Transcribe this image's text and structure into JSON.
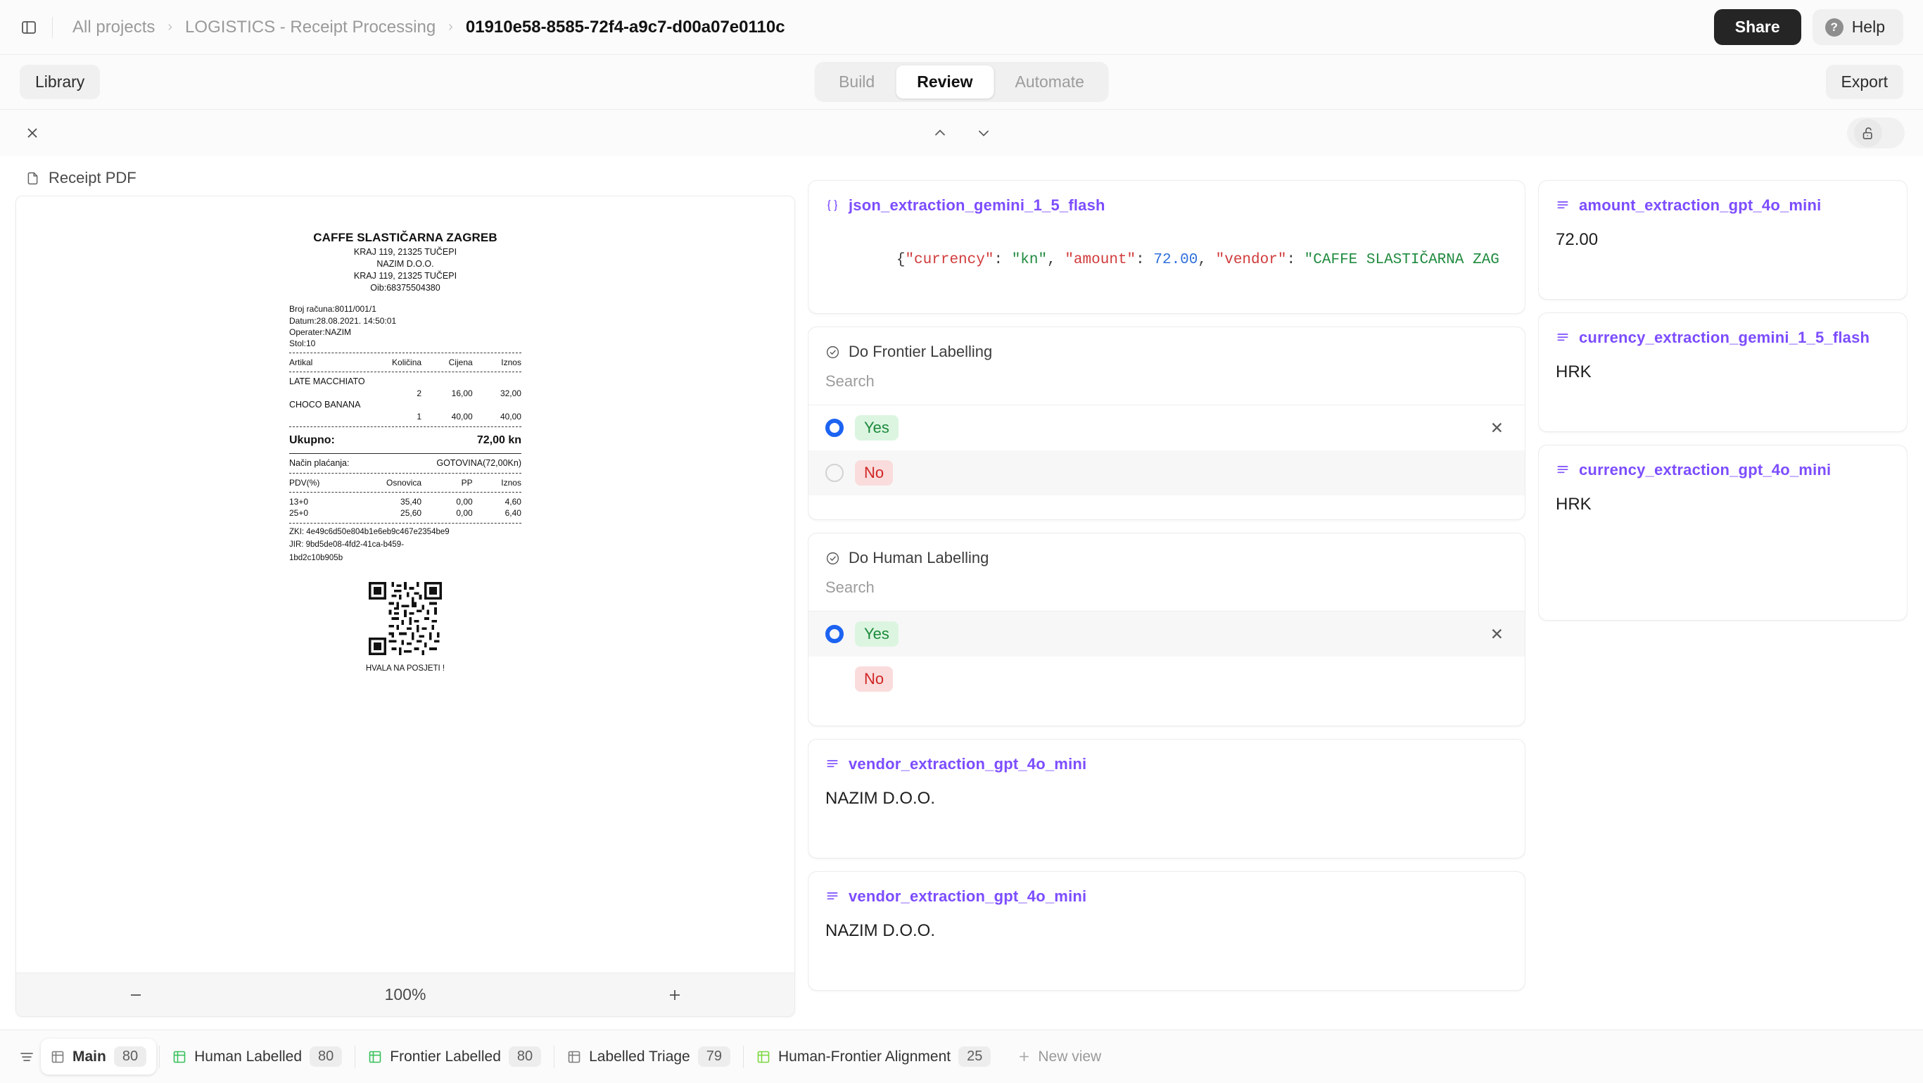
{
  "topbar": {
    "panel_toggle_icon": "panel-left-icon",
    "breadcrumb": [
      {
        "label": "All projects",
        "active": false
      },
      {
        "label": "LOGISTICS - Receipt Processing",
        "active": false
      },
      {
        "label": "01910e58-8585-72f4-a9c7-d00a07e0110c",
        "active": true
      }
    ],
    "separator": "›",
    "share_label": "Share",
    "help_label": "Help",
    "help_badge": "?"
  },
  "tabbar": {
    "library_label": "Library",
    "export_label": "Export",
    "tabs": [
      {
        "label": "Build",
        "active": false
      },
      {
        "label": "Review",
        "active": true
      },
      {
        "label": "Automate",
        "active": false
      }
    ]
  },
  "subbar": {
    "close_icon": "close-icon",
    "prev_icon": "chevron-up-icon",
    "next_icon": "chevron-down-icon",
    "lock_icon": "unlock-icon"
  },
  "pdf": {
    "tab_label": "Receipt PDF",
    "file_icon": "file-icon",
    "zoom_level": "100%",
    "zoom_out_icon": "minus-icon",
    "zoom_in_icon": "plus-icon"
  },
  "receipt": {
    "title": "CAFFE SLASTIČARNA ZAGREB",
    "address_lines": [
      "KRAJ 119, 21325 TUČEPI",
      "NAZIM D.O.O.",
      "KRAJ 119, 21325 TUČEPI",
      "Oib:68375504380"
    ],
    "meta": [
      "Broj računa:8011/001/1",
      "Datum:28.08.2021.  14:50:01",
      "Operater:NAZIM",
      "Stol:10"
    ],
    "items_header": [
      "Artikal",
      "Količina",
      "Cijena",
      "Iznos"
    ],
    "items": [
      {
        "name": "LATE MACCHIATO",
        "qty": "2",
        "price": "16,00",
        "amount": "32,00"
      },
      {
        "name": "CHOCO BANANA",
        "qty": "1",
        "price": "40,00",
        "amount": "40,00"
      }
    ],
    "total_label": "Ukupno:",
    "total_value": "72,00 kn",
    "payment_label": "Način plaćanja:",
    "payment_value": "GOTOVINA(72,00Kn)",
    "tax_header": [
      "PDV(%)",
      "Osnovica",
      "PP",
      "Iznos"
    ],
    "tax_rows": [
      {
        "rate": "13+0",
        "base": "35,40",
        "pp": "0,00",
        "amount": "4,60"
      },
      {
        "rate": "25+0",
        "base": "25,60",
        "pp": "0,00",
        "amount": "6,40"
      }
    ],
    "zki": "ZKI: 4e49c6d50e804b1e6eb9c467e2354be9",
    "jir_line1": "JIR: 9bd5de08-4fd2-41ca-b459-",
    "jir_line2": "1bd2c10b905b",
    "footer": "HVALA NA POSJETI !"
  },
  "middle": {
    "json_card": {
      "title": "json_extraction_gemini_1_5_flash",
      "icon": "braces-icon",
      "tokens": [
        {
          "t": "{",
          "c": "punc"
        },
        {
          "t": "\"currency\"",
          "c": "key"
        },
        {
          "t": ": ",
          "c": "punc"
        },
        {
          "t": "\"kn\"",
          "c": "str"
        },
        {
          "t": ", ",
          "c": "punc"
        },
        {
          "t": "\"amount\"",
          "c": "key"
        },
        {
          "t": ": ",
          "c": "punc"
        },
        {
          "t": "72.00",
          "c": "num"
        },
        {
          "t": ", ",
          "c": "punc"
        },
        {
          "t": "\"vendor\"",
          "c": "key"
        },
        {
          "t": ": ",
          "c": "punc"
        },
        {
          "t": "\"CAFFE SLASTIČARNA ZAG",
          "c": "str"
        }
      ]
    },
    "labelling": [
      {
        "title": "Do Frontier Labelling",
        "icon": "check-circle-icon",
        "search_placeholder": "Search",
        "search_value": "",
        "options": [
          {
            "label": "Yes",
            "tone": "yes",
            "selected": true,
            "hover": false,
            "has_radio": true,
            "clear_icon": "close-icon"
          },
          {
            "label": "No",
            "tone": "no",
            "selected": false,
            "hover": true,
            "has_radio": true,
            "clear_icon": ""
          }
        ]
      },
      {
        "title": "Do Human Labelling",
        "icon": "check-circle-icon",
        "search_placeholder": "Search",
        "search_value": "",
        "options": [
          {
            "label": "Yes",
            "tone": "yes",
            "selected": true,
            "hover": true,
            "has_radio": true,
            "clear_icon": "close-icon"
          },
          {
            "label": "No",
            "tone": "no",
            "selected": false,
            "hover": false,
            "has_radio": false,
            "clear_icon": ""
          }
        ]
      }
    ],
    "value_cards": [
      {
        "title": "vendor_extraction_gpt_4o_mini",
        "icon": "text-lines-icon",
        "value": "NAZIM D.O.O."
      },
      {
        "title": "vendor_extraction_gpt_4o_mini",
        "icon": "text-lines-icon",
        "value": "NAZIM D.O.O."
      }
    ]
  },
  "right": {
    "cards": [
      {
        "title": "amount_extraction_gpt_4o_mini",
        "icon": "text-lines-icon",
        "value": "72.00"
      },
      {
        "title": "currency_extraction_gemini_1_5_flash",
        "icon": "text-lines-icon",
        "value": "HRK"
      },
      {
        "title": "currency_extraction_gpt_4o_mini",
        "icon": "text-lines-icon",
        "value": "HRK"
      }
    ]
  },
  "bottombar": {
    "filter_icon": "filter-icon",
    "new_view_label": "New view",
    "new_view_icon": "plus-icon",
    "views": [
      {
        "label": "Main",
        "count": "80",
        "active": true,
        "icon_color": "#7d7d7d"
      },
      {
        "label": "Human Labelled",
        "count": "80",
        "active": false,
        "icon_color": "#36c05a"
      },
      {
        "label": "Frontier Labelled",
        "count": "80",
        "active": false,
        "icon_color": "#36c05a"
      },
      {
        "label": "Labelled Triage",
        "count": "79",
        "active": false,
        "icon_color": "#7d7d7d"
      },
      {
        "label": "Human-Frontier Alignment",
        "count": "25",
        "active": false,
        "icon_color": "#7bd93f"
      }
    ]
  },
  "colors": {
    "accent_purple": "#7c4dff",
    "radio_blue": "#1c63f2",
    "yes_green": "#1b8a3a",
    "no_red": "#d02525"
  }
}
